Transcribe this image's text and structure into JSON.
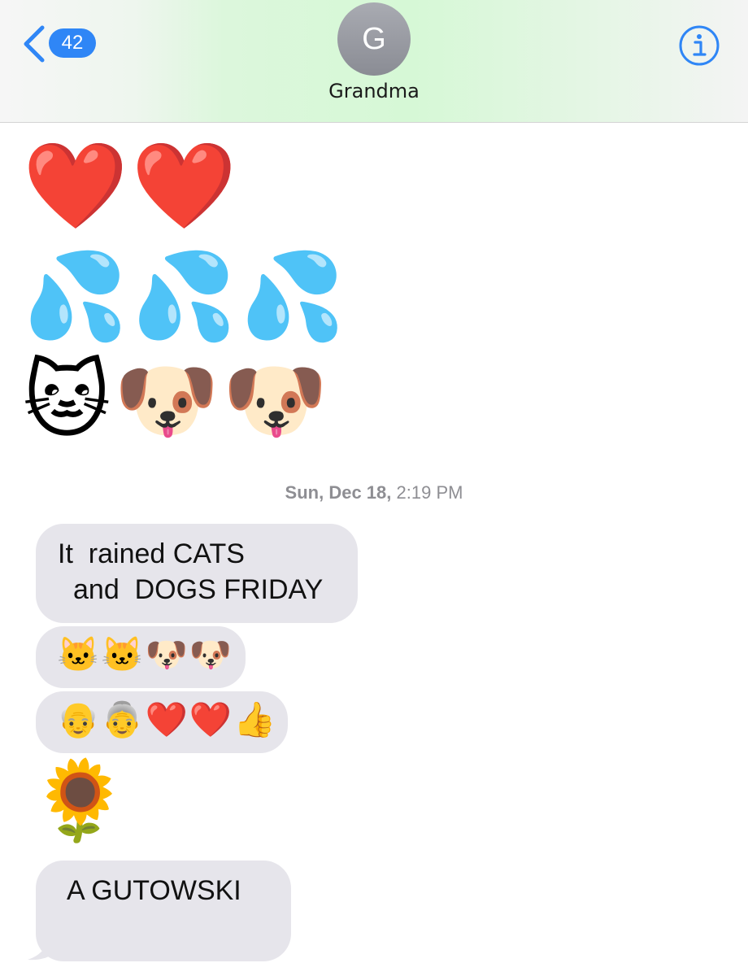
{
  "header": {
    "back_badge_count": "42",
    "avatar_initial": "G",
    "contact_name": "Grandma",
    "accent_color": "#2f86f6",
    "icons": {
      "back": "chevron-left-icon",
      "info": "info-icon"
    }
  },
  "messages": {
    "hearts_row": "❤️❤️",
    "drops_row": "💦💦💦",
    "pets_row": "🐱🐶🐶",
    "timestamp": {
      "date": "Sun, Dec 18,",
      "time": "2:19 PM"
    },
    "text_bubble_1": {
      "line1": "It  rained CATS",
      "line2": "and  DOGS FRIDAY"
    },
    "emoji_bubble_1": "🐱🐱🐶🐶",
    "emoji_bubble_2": "👴👵❤️❤️👍",
    "sunflower": "🌻",
    "text_bubble_2": "A GUTOWSKI"
  }
}
